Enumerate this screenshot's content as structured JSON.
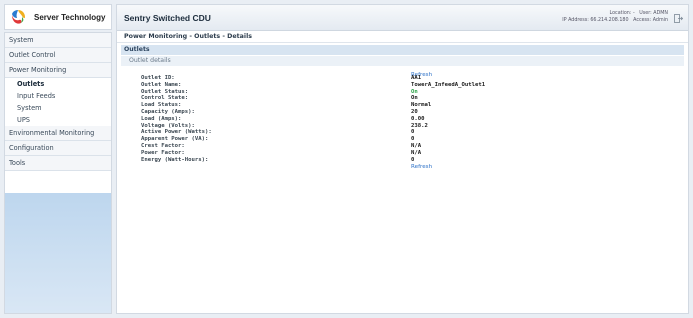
{
  "brand": {
    "name": "Server Technology"
  },
  "nav": {
    "items": [
      {
        "label": "System",
        "type": "top"
      },
      {
        "label": "Outlet Control",
        "type": "top"
      },
      {
        "label": "Power Monitoring",
        "type": "top"
      },
      {
        "label": "Outlets",
        "type": "sub",
        "active": true
      },
      {
        "label": "Input Feeds",
        "type": "sub"
      },
      {
        "label": "System",
        "type": "sub"
      },
      {
        "label": "UPS",
        "type": "sub"
      },
      {
        "label": "Environmental Monitoring",
        "type": "top"
      },
      {
        "label": "Configuration",
        "type": "top"
      },
      {
        "label": "Tools",
        "type": "top"
      }
    ]
  },
  "header": {
    "title": "Sentry Switched CDU",
    "location_label": "Location:",
    "location_value": "-",
    "user_label": "User:",
    "user_value": "ADMN",
    "ip_label": "IP Address:",
    "ip_value": "66.214.208.180",
    "access_label": "Access:",
    "access_value": "Admin"
  },
  "breadcrumb": "Power Monitoring - Outlets - Details",
  "section_title": "Outlets",
  "subsection_title": "Outlet details",
  "refresh_label": "Refresh",
  "details": [
    {
      "label": "Outlet ID:",
      "value": "AA1"
    },
    {
      "label": "Outlet Name:",
      "value": "TowerA_InfeedA_Outlet1"
    },
    {
      "label": "Outlet Status:",
      "value": "On",
      "status": true
    },
    {
      "label": "Control State:",
      "value": "On"
    },
    {
      "label": "Load Status:",
      "value": "Normal"
    },
    {
      "label": "Capacity (Amps):",
      "value": "20"
    },
    {
      "label": "Load (Amps):",
      "value": "0.00"
    },
    {
      "label": "Voltage (Volts):",
      "value": "238.2"
    },
    {
      "label": "Active Power (Watts):",
      "value": "0"
    },
    {
      "label": "Apparent Power (VA):",
      "value": "0"
    },
    {
      "label": "Crest Factor:",
      "value": "N/A"
    },
    {
      "label": "Power Factor:",
      "value": "N/A"
    },
    {
      "label": "Energy (Watt-Hours):",
      "value": "0"
    }
  ],
  "colors": {
    "accent": "#2f73c8",
    "status_on": "#2ea44a",
    "nav_fill": "#bdd6ee"
  },
  "icons": {
    "logo": "server-technology-logo",
    "logout": "logout-icon"
  }
}
